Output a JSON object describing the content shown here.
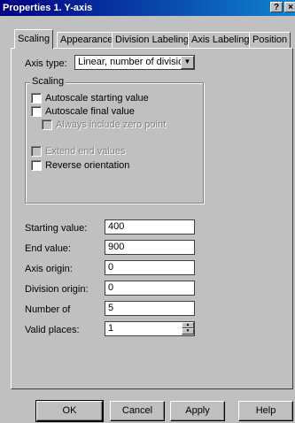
{
  "window": {
    "title": "Properties 1. Y-axis",
    "help_btn": "?",
    "close_btn": "×"
  },
  "tabs": [
    {
      "label": "Scaling",
      "active": true
    },
    {
      "label": "Appearance",
      "active": false
    },
    {
      "label": "Division Labeling",
      "active": false
    },
    {
      "label": "Axis Labeling",
      "active": false
    },
    {
      "label": "Position",
      "active": false
    }
  ],
  "axis_type": {
    "label": "Axis type:",
    "value": "Linear, number of divisions"
  },
  "scaling_group": {
    "title": "Scaling",
    "options": [
      {
        "label": "Autoscale starting value",
        "checked": false,
        "enabled": true
      },
      {
        "label": "Autoscale final value",
        "checked": false,
        "enabled": true
      },
      {
        "label": "Always include zero point",
        "checked": false,
        "enabled": false
      },
      {
        "label": "Extend end values",
        "checked": false,
        "enabled": false
      },
      {
        "label": "Reverse orientation",
        "checked": false,
        "enabled": true
      }
    ]
  },
  "fields": [
    {
      "label": "Starting value:",
      "value": "400"
    },
    {
      "label": "End value:",
      "value": "900"
    },
    {
      "label": "Axis origin:",
      "value": "0"
    },
    {
      "label": "Division origin:",
      "value": "0"
    },
    {
      "label": "Number of",
      "value": "5"
    },
    {
      "label": "Valid places:",
      "value": "1"
    }
  ],
  "buttons": {
    "ok": "OK",
    "cancel": "Cancel",
    "apply": "Apply",
    "help": "Help"
  }
}
